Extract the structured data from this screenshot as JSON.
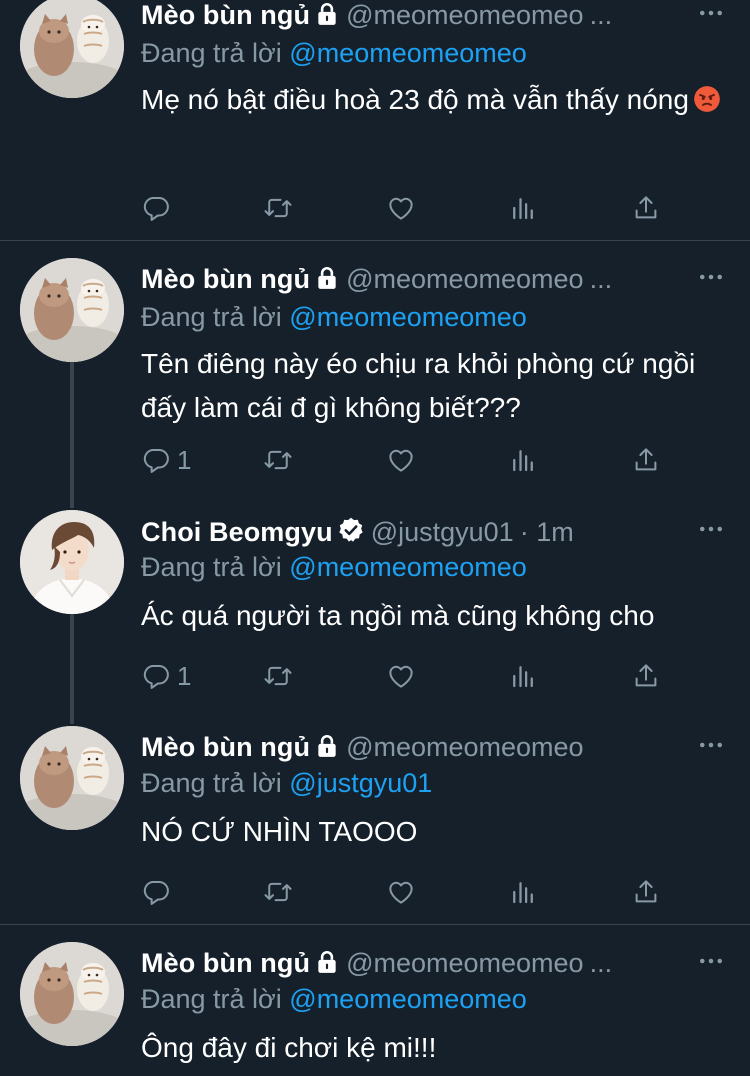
{
  "tweets": [
    {
      "name": "Mèo bùn ngủ",
      "handle": "@meomeomeomeo",
      "ellipsis": "...",
      "reply_prefix": "Đang trả lời",
      "reply_to": "@meomeomeomeo",
      "text": "Mẹ nó bật điều hoà 23 độ mà vẫn thấy nóng",
      "emoji": "angry-face-icon",
      "reply_count": ""
    },
    {
      "name": "Mèo bùn ngủ",
      "handle": "@meomeomeomeo",
      "ellipsis": "...",
      "reply_prefix": "Đang trả lời",
      "reply_to": "@meomeomeomeo",
      "text": "Tên điêng này éo chịu ra khỏi phòng cứ ngồi đấy làm cái đ gì không biết???",
      "reply_count": "1"
    },
    {
      "name": "Choi Beomgyu",
      "handle": "@justgyu01",
      "time": "· 1m",
      "reply_prefix": "Đang trả lời",
      "reply_to": "@meomeomeomeo",
      "text": "Ác quá người ta ngồi mà cũng không cho",
      "reply_count": "1"
    },
    {
      "name": "Mèo bùn ngủ",
      "handle": "@meomeomeomeo",
      "reply_prefix": "Đang trả lời",
      "reply_to": "@justgyu01",
      "text": "NÓ CỨ NHÌN TAOOO",
      "reply_count": ""
    },
    {
      "name": "Mèo bùn ngủ",
      "handle": "@meomeomeomeo",
      "ellipsis": "...",
      "reply_prefix": "Đang trả lời",
      "reply_to": "@meomeomeomeo",
      "text": "Ông đây đi chơi kệ mi!!!"
    }
  ],
  "icons": {
    "lock": "lock-icon",
    "verified": "verified-badge-icon",
    "more": "more-icon",
    "reply": "reply-icon",
    "retweet": "retweet-icon",
    "like": "like-icon",
    "analytics": "analytics-icon",
    "share": "share-icon"
  },
  "colors": {
    "background": "#15202b",
    "secondary_text": "#8899a6",
    "mention": "#1da1f2",
    "divider": "#38444d"
  }
}
